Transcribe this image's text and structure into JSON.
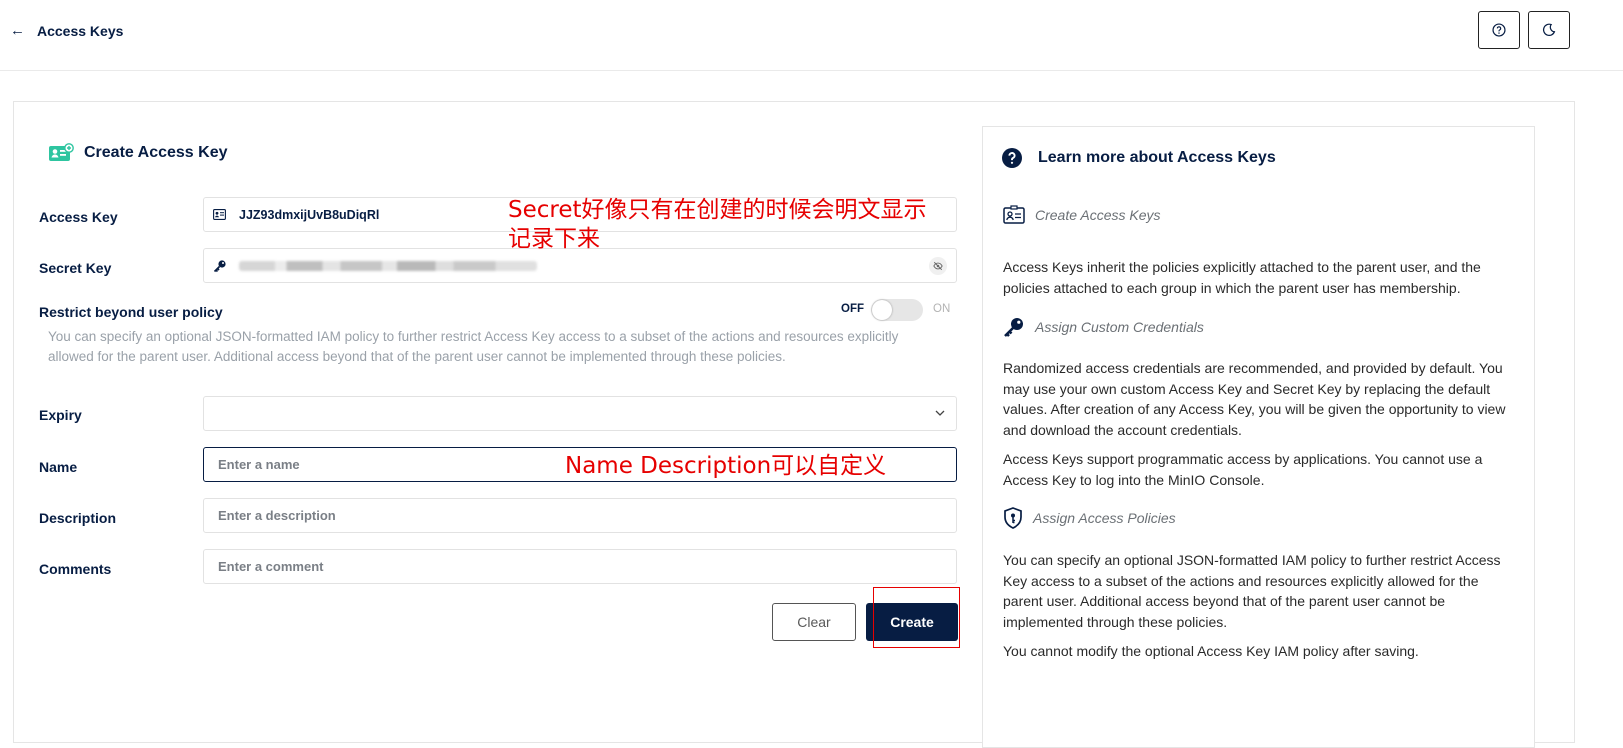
{
  "header": {
    "back_label": "Access Keys",
    "help_icon": "help-circle-icon",
    "theme_icon": "moon-icon"
  },
  "form": {
    "title": "Create Access Key",
    "access_key": {
      "label": "Access Key",
      "value": "JJZ93dmxijUvB8uDiqRl"
    },
    "secret_key": {
      "label": "Secret Key",
      "value_state": "masked/blurred"
    },
    "restrict": {
      "label": "Restrict beyond user policy",
      "off_label": "OFF",
      "on_label": "ON",
      "description": "You can specify an optional JSON-formatted IAM policy to further restrict Access Key access to a subset of the actions and resources explicitly allowed for the parent user. Additional access beyond that of the parent user cannot be implemented through these policies."
    },
    "expiry": {
      "label": "Expiry",
      "value": ""
    },
    "name": {
      "label": "Name",
      "placeholder": "Enter a name"
    },
    "description": {
      "label": "Description",
      "placeholder": "Enter a description"
    },
    "comments": {
      "label": "Comments",
      "placeholder": "Enter a comment"
    },
    "clear_label": "Clear",
    "create_label": "Create"
  },
  "annotations": {
    "secret_note_line1": "Secret好像只有在创建的时候会明文显示",
    "secret_note_line2": "记录下来",
    "name_note": "Name Description可以自定义"
  },
  "help": {
    "title": "Learn more about Access Keys",
    "sections": [
      {
        "subtitle": "Create Access Keys",
        "paragraphs": [
          "Access Keys inherit the policies explicitly attached to the parent user, and the policies attached to each group in which the parent user has membership."
        ]
      },
      {
        "subtitle": "Assign Custom Credentials",
        "paragraphs": [
          "Randomized access credentials are recommended, and provided by default. You may use your own custom Access Key and Secret Key by replacing the default values. After creation of any Access Key, you will be given the opportunity to view and download the account credentials.",
          "Access Keys support programmatic access by applications. You cannot use a Access Key to log into the MinIO Console."
        ]
      },
      {
        "subtitle": "Assign Access Policies",
        "paragraphs": [
          "You can specify an optional JSON-formatted IAM policy to further restrict Access Key access to a subset of the actions and resources explicitly allowed for the parent user. Additional access beyond that of the parent user cannot be implemented through these policies.",
          "You cannot modify the optional Access Key IAM policy after saving."
        ]
      }
    ]
  },
  "colors": {
    "primary": "#071D43",
    "accent_green": "#2EC5A0",
    "annotation_red": "#E60000"
  }
}
